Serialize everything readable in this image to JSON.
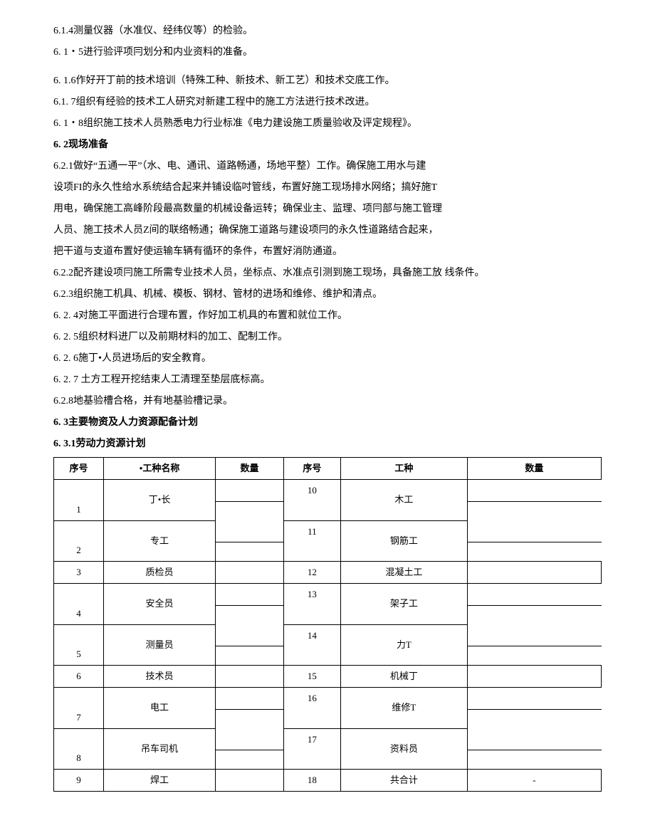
{
  "paragraphs": [
    {
      "text": "6.1.4测量仪器（水准仪、经纬仪等）的检验。",
      "bold": false
    },
    {
      "text": "6. 1・5进行验评项冃划分和内业资料的准备。",
      "bold": false
    },
    {
      "text": "",
      "bold": false
    },
    {
      "text": "6. 1.6作好开丁前的技术培训（特殊工种、新技术、新工艺）和技术交底工作。",
      "bold": false
    },
    {
      "text": "6.1. 7组织有经验的技术工人研究对新建工程中的施工方法进行技术改进。",
      "bold": false
    },
    {
      "text": "6. 1・8组织施工技术人员熟悉电力行业标准《电力建设施工质量验收及评定规程》。",
      "bold": false
    },
    {
      "text": "6. 2现场准备",
      "bold": true
    },
    {
      "text": "6.2.1做好“五通一平”（水、电、通讯、道路畅通，场地平整）工作。确保施工用水与建",
      "bold": false
    },
    {
      "text": "设项FI的永久性给水系统结合起来并铺设临吋管线，布置好施工现场排水网络；搞好施T",
      "bold": false
    },
    {
      "text": "用电，确保施工高峰阶段最高数量的机械设备运转；确保业主、监理、项冃部与施工管理",
      "bold": false
    },
    {
      "text": "人员、施工技术人员Z间的联络畅通；确保施工道路与建设项冃的永久性道路结合起来，",
      "bold": false
    },
    {
      "text": "把干道与支道布置好使运输车辆有循环的条件，布置好消防通道。",
      "bold": false
    },
    {
      "text": "6.2.2配齐建设项冃施工所需专业技术人员，坐标点、水准点引测到施工现场，具备施工放  线条件。",
      "bold": false
    },
    {
      "text": "6.2.3组织施工机具、机械、模板、钢材、管材的进场和维修、维护和清点。",
      "bold": false
    },
    {
      "text": "6. 2. 4对施工平面进行合理布置，作好加工机具的布置和就位工作。",
      "bold": false
    },
    {
      "text": "6. 2. 5组织材料进厂以及前期材料的加工、配制工作。",
      "bold": false
    },
    {
      "text": "6. 2. 6施丁•人员进场后的安全教育。",
      "bold": false
    },
    {
      "text": "6. 2. 7  土方工程开挖结束人工清理至垫层底标高。",
      "bold": false
    },
    {
      "text": "6.2.8地基验槽合格，并有地基验槽记录。",
      "bold": false
    },
    {
      "text": "6. 3主要物资及人力资源配备计划",
      "bold": true
    },
    {
      "text": "6. 3.1劳动力资源计划",
      "bold": true
    }
  ],
  "table": {
    "headers": [
      "序号",
      "•工种名称",
      "数量",
      "序号",
      "工种",
      "数量"
    ],
    "rows": [
      {
        "c1": "1",
        "c2": "丁•长",
        "c3": "",
        "c4": "10",
        "c5": "木工",
        "c6": "",
        "split": true
      },
      {
        "c1": "2",
        "c2": "专工",
        "c3": "",
        "c4": "11",
        "c5": "钢筋工",
        "c6": "",
        "split": true
      },
      {
        "c1": "3",
        "c2": "质检员",
        "c3": "",
        "c4": "12",
        "c5": "混凝土工",
        "c6": "",
        "split": false
      },
      {
        "c1": "4",
        "c2": "安全员",
        "c3": "",
        "c4": "13",
        "c5": "架子工",
        "c6": "",
        "split": true
      },
      {
        "c1": "5",
        "c2": "测量员",
        "c3": "",
        "c4": "14",
        "c5": "力T",
        "c6": "",
        "split": true
      },
      {
        "c1": "6",
        "c2": "技术员",
        "c3": "",
        "c4": "15",
        "c5": "机械丁",
        "c6": "",
        "split": false
      },
      {
        "c1": "7",
        "c2": "电工",
        "c3": "",
        "c4": "16",
        "c5": "维修T",
        "c6": "",
        "split": true
      },
      {
        "c1": "8",
        "c2": "吊车司机",
        "c3": "",
        "c4": "17",
        "c5": "资料员",
        "c6": "",
        "split": true
      },
      {
        "c1": "9",
        "c2": "焊工",
        "c3": "",
        "c4": "18",
        "c5": "共合计",
        "c6": "-",
        "split": false
      }
    ]
  }
}
